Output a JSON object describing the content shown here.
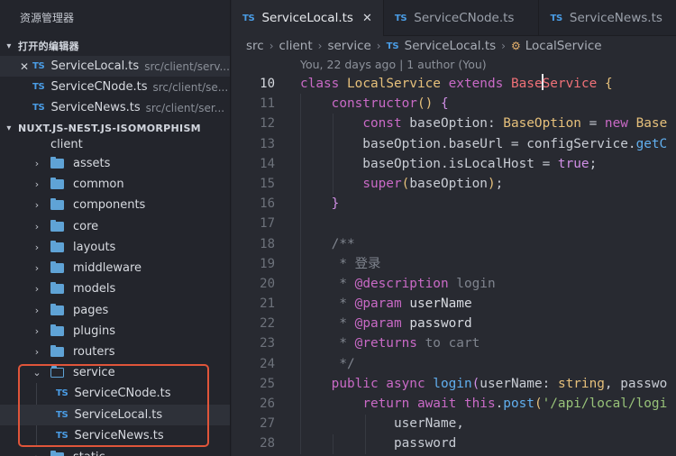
{
  "sidebar": {
    "title": "资源管理器",
    "open_editors_header": "打开的编辑器",
    "open_editors": [
      {
        "badge": "TS",
        "name": "ServiceLocal.ts",
        "path": "src/client/serv...",
        "close": "✕"
      },
      {
        "badge": "TS",
        "name": "ServiceCNode.ts",
        "path": "src/client/se..."
      },
      {
        "badge": "TS",
        "name": "ServiceNews.ts",
        "path": "src/client/ser..."
      }
    ],
    "project_header": "NUXT.JS-NEST.JS-ISOMORPHISM",
    "tree": {
      "client": "client",
      "folders": [
        "assets",
        "common",
        "components",
        "core",
        "layouts",
        "middleware",
        "models",
        "pages",
        "plugins",
        "routers"
      ],
      "service": "service",
      "service_files": [
        "ServiceCNode.ts",
        "ServiceLocal.ts",
        "ServiceNews.ts"
      ],
      "static": "static"
    }
  },
  "tabs": [
    {
      "badge": "TS",
      "label": "ServiceLocal.ts",
      "close": "✕"
    },
    {
      "badge": "TS",
      "label": "ServiceCNode.ts"
    },
    {
      "badge": "TS",
      "label": "ServiceNews.ts"
    }
  ],
  "breadcrumb": {
    "parts": [
      "src",
      "client",
      "service"
    ],
    "file_badge": "TS",
    "file": "ServiceLocal.ts",
    "symbol": "LocalService"
  },
  "blame": "You, 22 days ago | 1 author (You)",
  "code": {
    "line_numbers": [
      "10",
      "11",
      "12",
      "13",
      "14",
      "15",
      "16",
      "17",
      "18",
      "19",
      "20",
      "21",
      "22",
      "23",
      "24",
      "25",
      "26",
      "27",
      "28"
    ],
    "current_line": "10"
  },
  "icons": {
    "folder": "folder-icon",
    "open_folder": "folder-open-icon",
    "ts_file": "typescript-file-icon",
    "chevron_right": "chevron-right-icon",
    "chevron_down": "chevron-down-icon",
    "close": "close-icon",
    "symbol_class": "class-symbol-icon"
  },
  "colors": {
    "ts_badge": "#4a9de6",
    "folder": "#5fa3d6",
    "highlight_box": "#e0553a",
    "keyword": "#c96ac6",
    "string": "#98c379",
    "function": "#61afef",
    "class": "#e6c07b"
  }
}
